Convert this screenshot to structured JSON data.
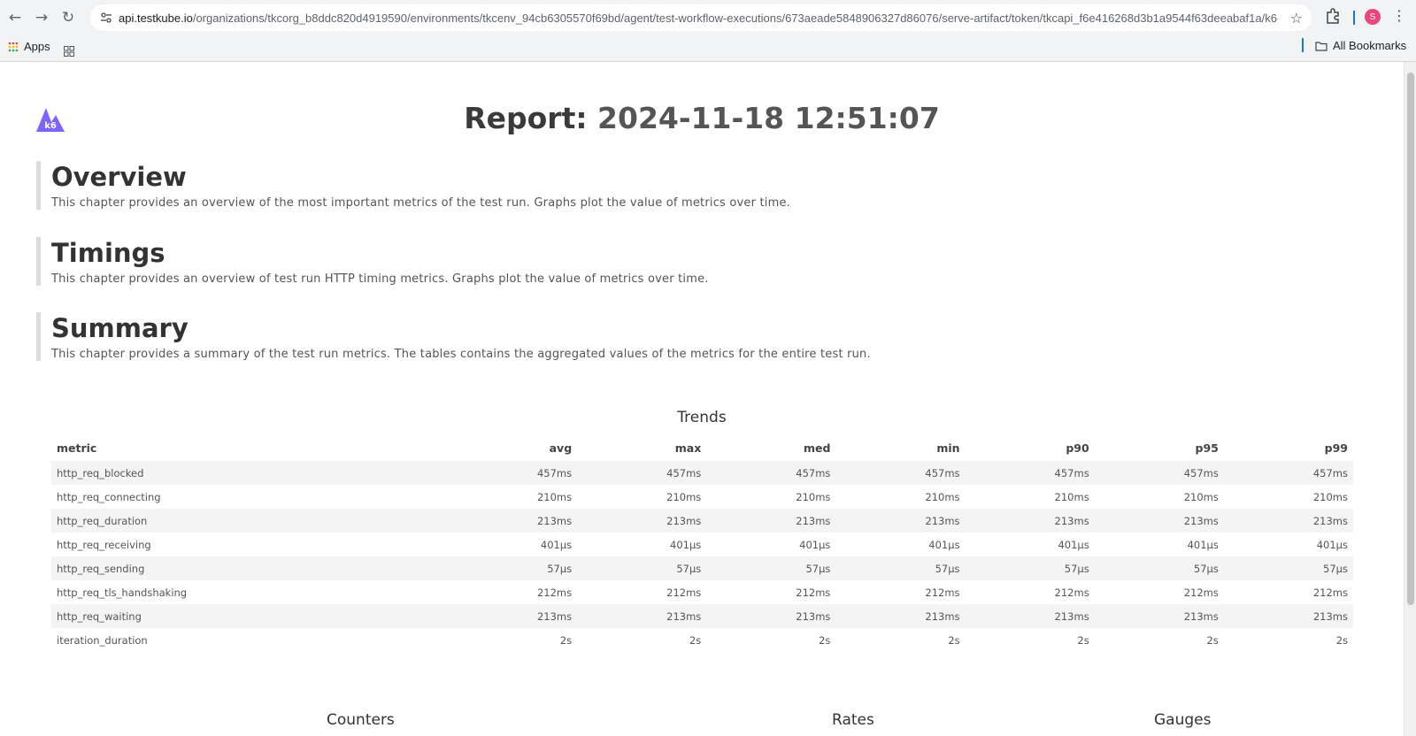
{
  "browser": {
    "url_host": "api.testkube.io",
    "url_path": "/organizations/tkcorg_b8ddc820d4919590/environments/tkcenv_94cb6305570f69bd/agent/test-workflow-executions/673aeade5848906327d86076/serve-artifact/token/tkcapi_f6e416268d3b1a9544f63deeabaf1a/k6-test-r...",
    "avatar_letter": "S",
    "bookmarks": {
      "apps_label": "Apps",
      "all_label": "All Bookmarks"
    }
  },
  "report": {
    "title_prefix": "Report:",
    "timestamp": "2024-11-18 12:51:07",
    "logo_text": "k6"
  },
  "chapters": [
    {
      "title": "Overview",
      "description": "This chapter provides an overview of the most important metrics of the test run. Graphs plot the value of metrics over time."
    },
    {
      "title": "Timings",
      "description": "This chapter provides an overview of test run HTTP timing metrics. Graphs plot the value of metrics over time."
    },
    {
      "title": "Summary",
      "description": "This chapter provides a summary of the test run metrics. The tables contains the aggregated values of the metrics for the entire test run."
    }
  ],
  "trends": {
    "title": "Trends",
    "columns": [
      "metric",
      "avg",
      "max",
      "med",
      "min",
      "p90",
      "p95",
      "p99"
    ],
    "rows": [
      [
        "http_req_blocked",
        "457ms",
        "457ms",
        "457ms",
        "457ms",
        "457ms",
        "457ms",
        "457ms"
      ],
      [
        "http_req_connecting",
        "210ms",
        "210ms",
        "210ms",
        "210ms",
        "210ms",
        "210ms",
        "210ms"
      ],
      [
        "http_req_duration",
        "213ms",
        "213ms",
        "213ms",
        "213ms",
        "213ms",
        "213ms",
        "213ms"
      ],
      [
        "http_req_receiving",
        "401µs",
        "401µs",
        "401µs",
        "401µs",
        "401µs",
        "401µs",
        "401µs"
      ],
      [
        "http_req_sending",
        "57µs",
        "57µs",
        "57µs",
        "57µs",
        "57µs",
        "57µs",
        "57µs"
      ],
      [
        "http_req_tls_handshaking",
        "212ms",
        "212ms",
        "212ms",
        "212ms",
        "212ms",
        "212ms",
        "212ms"
      ],
      [
        "http_req_waiting",
        "213ms",
        "213ms",
        "213ms",
        "213ms",
        "213ms",
        "213ms",
        "213ms"
      ],
      [
        "iteration_duration",
        "2s",
        "2s",
        "2s",
        "2s",
        "2s",
        "2s",
        "2s"
      ]
    ]
  },
  "bottom_sections": [
    "Counters",
    "Rates",
    "Gauges"
  ],
  "colors": {
    "logo": "#7d64ff",
    "accent": "#1a73e8",
    "avatar": "#e8467c"
  }
}
